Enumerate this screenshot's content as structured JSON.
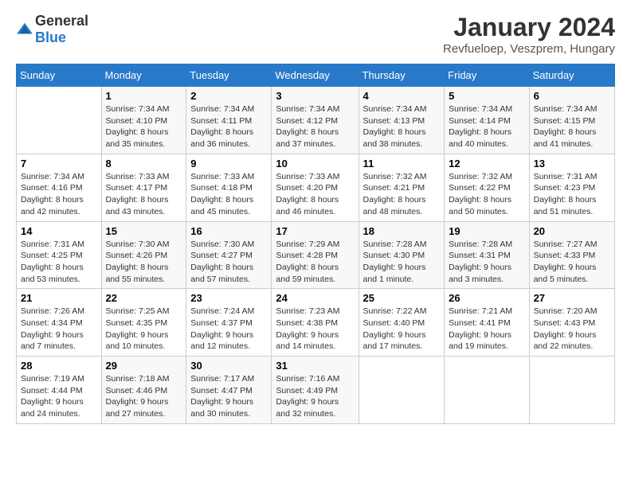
{
  "logo": {
    "text_general": "General",
    "text_blue": "Blue"
  },
  "title": "January 2024",
  "subtitle": "Revfueloep, Veszprem, Hungary",
  "days_of_week": [
    "Sunday",
    "Monday",
    "Tuesday",
    "Wednesday",
    "Thursday",
    "Friday",
    "Saturday"
  ],
  "weeks": [
    [
      {
        "day": "",
        "info": ""
      },
      {
        "day": "1",
        "info": "Sunrise: 7:34 AM\nSunset: 4:10 PM\nDaylight: 8 hours\nand 35 minutes."
      },
      {
        "day": "2",
        "info": "Sunrise: 7:34 AM\nSunset: 4:11 PM\nDaylight: 8 hours\nand 36 minutes."
      },
      {
        "day": "3",
        "info": "Sunrise: 7:34 AM\nSunset: 4:12 PM\nDaylight: 8 hours\nand 37 minutes."
      },
      {
        "day": "4",
        "info": "Sunrise: 7:34 AM\nSunset: 4:13 PM\nDaylight: 8 hours\nand 38 minutes."
      },
      {
        "day": "5",
        "info": "Sunrise: 7:34 AM\nSunset: 4:14 PM\nDaylight: 8 hours\nand 40 minutes."
      },
      {
        "day": "6",
        "info": "Sunrise: 7:34 AM\nSunset: 4:15 PM\nDaylight: 8 hours\nand 41 minutes."
      }
    ],
    [
      {
        "day": "7",
        "info": "Sunrise: 7:34 AM\nSunset: 4:16 PM\nDaylight: 8 hours\nand 42 minutes."
      },
      {
        "day": "8",
        "info": "Sunrise: 7:33 AM\nSunset: 4:17 PM\nDaylight: 8 hours\nand 43 minutes."
      },
      {
        "day": "9",
        "info": "Sunrise: 7:33 AM\nSunset: 4:18 PM\nDaylight: 8 hours\nand 45 minutes."
      },
      {
        "day": "10",
        "info": "Sunrise: 7:33 AM\nSunset: 4:20 PM\nDaylight: 8 hours\nand 46 minutes."
      },
      {
        "day": "11",
        "info": "Sunrise: 7:32 AM\nSunset: 4:21 PM\nDaylight: 8 hours\nand 48 minutes."
      },
      {
        "day": "12",
        "info": "Sunrise: 7:32 AM\nSunset: 4:22 PM\nDaylight: 8 hours\nand 50 minutes."
      },
      {
        "day": "13",
        "info": "Sunrise: 7:31 AM\nSunset: 4:23 PM\nDaylight: 8 hours\nand 51 minutes."
      }
    ],
    [
      {
        "day": "14",
        "info": "Sunrise: 7:31 AM\nSunset: 4:25 PM\nDaylight: 8 hours\nand 53 minutes."
      },
      {
        "day": "15",
        "info": "Sunrise: 7:30 AM\nSunset: 4:26 PM\nDaylight: 8 hours\nand 55 minutes."
      },
      {
        "day": "16",
        "info": "Sunrise: 7:30 AM\nSunset: 4:27 PM\nDaylight: 8 hours\nand 57 minutes."
      },
      {
        "day": "17",
        "info": "Sunrise: 7:29 AM\nSunset: 4:28 PM\nDaylight: 8 hours\nand 59 minutes."
      },
      {
        "day": "18",
        "info": "Sunrise: 7:28 AM\nSunset: 4:30 PM\nDaylight: 9 hours\nand 1 minute."
      },
      {
        "day": "19",
        "info": "Sunrise: 7:28 AM\nSunset: 4:31 PM\nDaylight: 9 hours\nand 3 minutes."
      },
      {
        "day": "20",
        "info": "Sunrise: 7:27 AM\nSunset: 4:33 PM\nDaylight: 9 hours\nand 5 minutes."
      }
    ],
    [
      {
        "day": "21",
        "info": "Sunrise: 7:26 AM\nSunset: 4:34 PM\nDaylight: 9 hours\nand 7 minutes."
      },
      {
        "day": "22",
        "info": "Sunrise: 7:25 AM\nSunset: 4:35 PM\nDaylight: 9 hours\nand 10 minutes."
      },
      {
        "day": "23",
        "info": "Sunrise: 7:24 AM\nSunset: 4:37 PM\nDaylight: 9 hours\nand 12 minutes."
      },
      {
        "day": "24",
        "info": "Sunrise: 7:23 AM\nSunset: 4:38 PM\nDaylight: 9 hours\nand 14 minutes."
      },
      {
        "day": "25",
        "info": "Sunrise: 7:22 AM\nSunset: 4:40 PM\nDaylight: 9 hours\nand 17 minutes."
      },
      {
        "day": "26",
        "info": "Sunrise: 7:21 AM\nSunset: 4:41 PM\nDaylight: 9 hours\nand 19 minutes."
      },
      {
        "day": "27",
        "info": "Sunrise: 7:20 AM\nSunset: 4:43 PM\nDaylight: 9 hours\nand 22 minutes."
      }
    ],
    [
      {
        "day": "28",
        "info": "Sunrise: 7:19 AM\nSunset: 4:44 PM\nDaylight: 9 hours\nand 24 minutes."
      },
      {
        "day": "29",
        "info": "Sunrise: 7:18 AM\nSunset: 4:46 PM\nDaylight: 9 hours\nand 27 minutes."
      },
      {
        "day": "30",
        "info": "Sunrise: 7:17 AM\nSunset: 4:47 PM\nDaylight: 9 hours\nand 30 minutes."
      },
      {
        "day": "31",
        "info": "Sunrise: 7:16 AM\nSunset: 4:49 PM\nDaylight: 9 hours\nand 32 minutes."
      },
      {
        "day": "",
        "info": ""
      },
      {
        "day": "",
        "info": ""
      },
      {
        "day": "",
        "info": ""
      }
    ]
  ]
}
